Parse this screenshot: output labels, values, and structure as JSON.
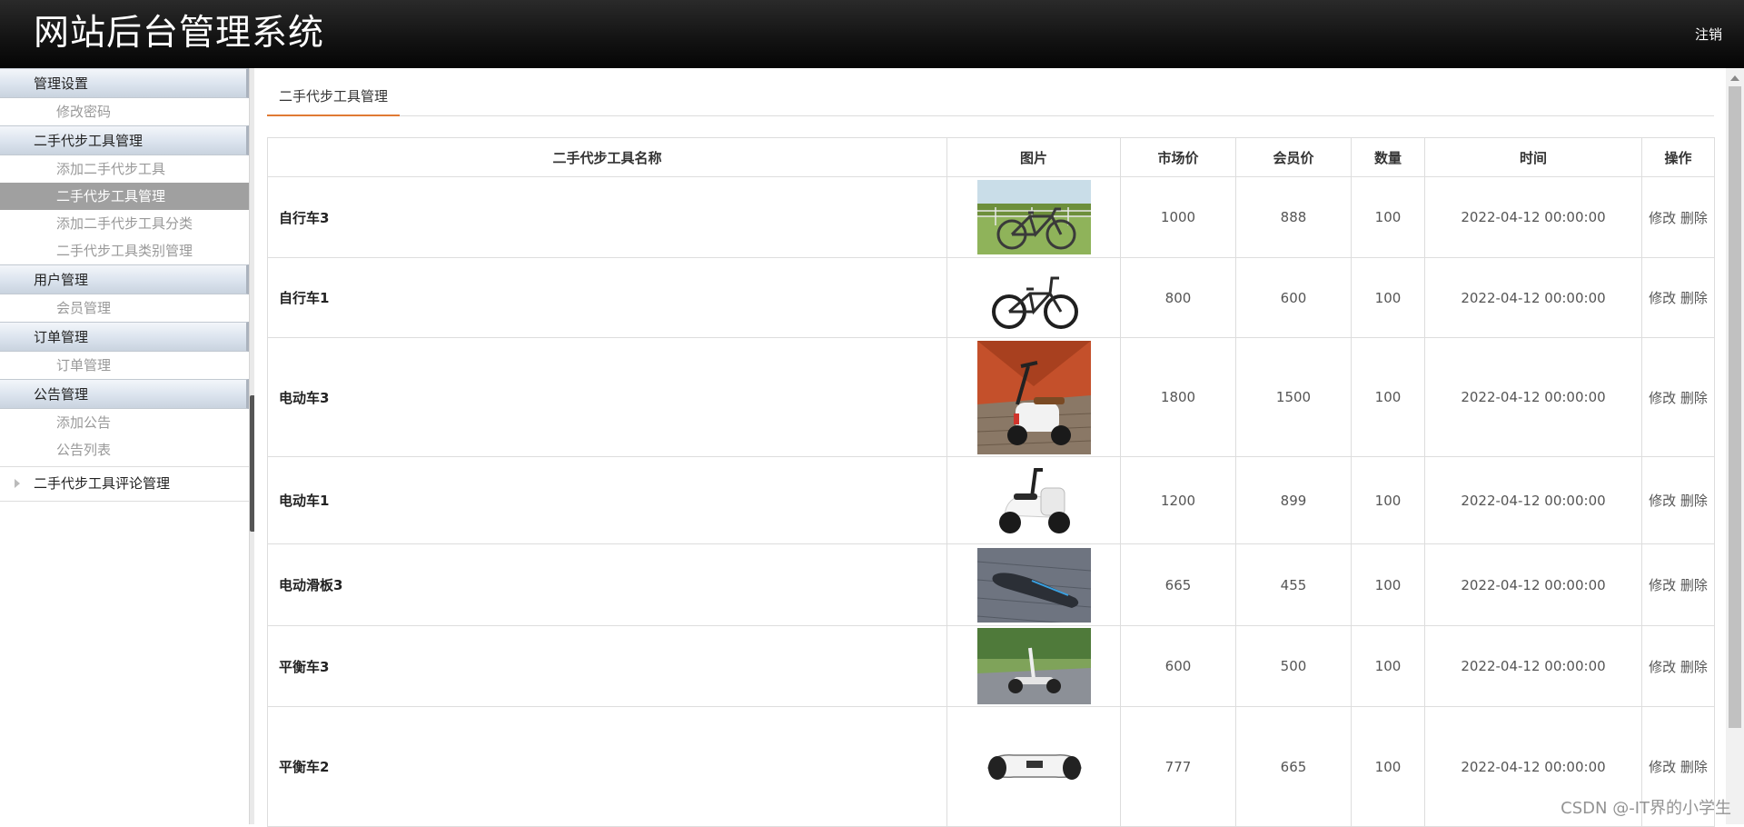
{
  "header": {
    "title": "网站后台管理系统",
    "logout_label": "注销"
  },
  "sidebar": {
    "groups": [
      {
        "title": "管理设置",
        "items": [
          "修改密码"
        ]
      },
      {
        "title": "二手代步工具管理",
        "items": [
          "添加二手代步工具",
          "二手代步工具管理",
          "添加二手代步工具分类",
          "二手代步工具类别管理"
        ]
      },
      {
        "title": "用户管理",
        "items": [
          "会员管理"
        ]
      },
      {
        "title": "订单管理",
        "items": [
          "订单管理"
        ]
      },
      {
        "title": "公告管理",
        "items": [
          "添加公告",
          "公告列表"
        ]
      }
    ],
    "tree_item": "二手代步工具评论管理"
  },
  "main": {
    "tab_label": "二手代步工具管理",
    "columns": [
      "二手代步工具名称",
      "图片",
      "市场价",
      "会员价",
      "数量",
      "时间",
      "操作"
    ],
    "edit_label": "修改",
    "delete_label": "删除",
    "rows": [
      {
        "name": "自行车3",
        "image": "bicycle-photo",
        "market": "1000",
        "member": "888",
        "qty": "100",
        "time": "2022-04-12 00:00:00"
      },
      {
        "name": "自行车1",
        "image": "bicycle-photo",
        "market": "800",
        "member": "600",
        "qty": "100",
        "time": "2022-04-12 00:00:00"
      },
      {
        "name": "电动车3",
        "image": "electric-scooter-photo",
        "market": "1800",
        "member": "1500",
        "qty": "100",
        "time": "2022-04-12 00:00:00"
      },
      {
        "name": "电动车1",
        "image": "electric-scooter-photo",
        "market": "1200",
        "member": "899",
        "qty": "100",
        "time": "2022-04-12 00:00:00"
      },
      {
        "name": "电动滑板3",
        "image": "electric-skateboard-photo",
        "market": "665",
        "member": "455",
        "qty": "100",
        "time": "2022-04-12 00:00:00"
      },
      {
        "name": "平衡车3",
        "image": "balance-scooter-photo",
        "market": "600",
        "member": "500",
        "qty": "100",
        "time": "2022-04-12 00:00:00"
      },
      {
        "name": "平衡车2",
        "image": "hoverboard-photo",
        "market": "777",
        "member": "665",
        "qty": "100",
        "time": "2022-04-12 00:00:00"
      }
    ]
  },
  "watermark": "CSDN @-IT界的小学生"
}
